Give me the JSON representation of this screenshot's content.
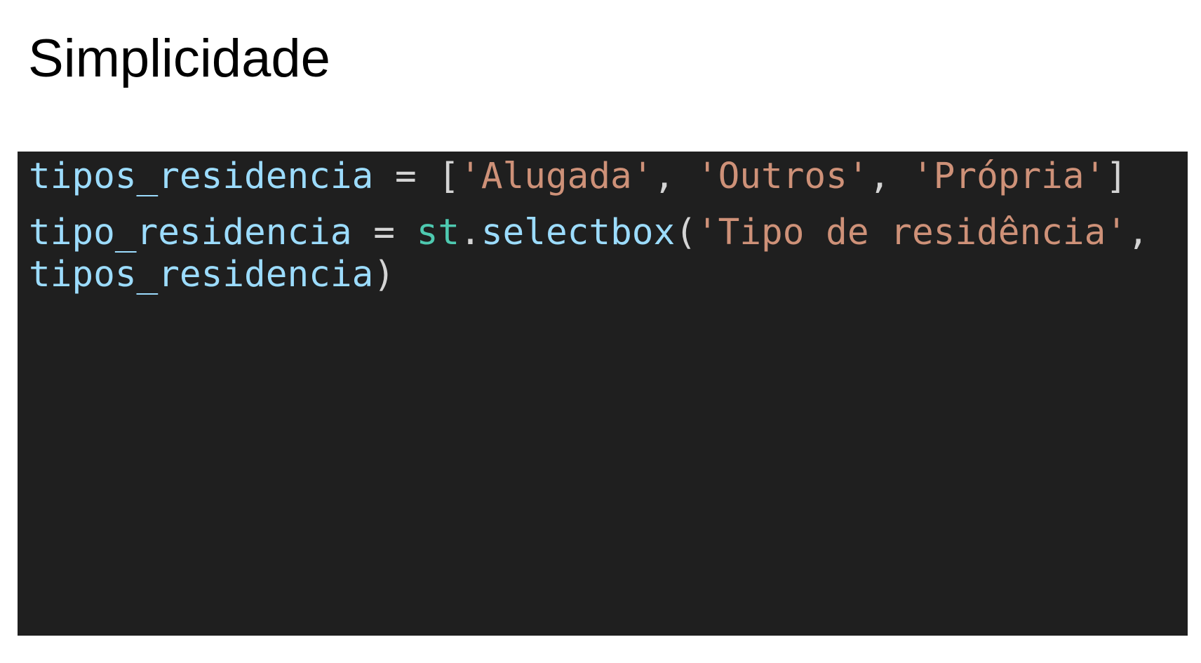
{
  "slide": {
    "title": "Simplicidade"
  },
  "code": {
    "line1": {
      "var": "tipos_residencia",
      "op": " = ",
      "open": "[",
      "s1": "'Alugada'",
      "c1": ", ",
      "s2": "'Outros'",
      "c2": ", ",
      "s3": "'Própria'",
      "close": "]"
    },
    "line2": {
      "var": "tipo_residencia",
      "op": " = ",
      "module": "st",
      "dot": ".",
      "func": "selectbox",
      "open": "(",
      "s1": "'Tipo de residência'",
      "comma": ","
    },
    "line3": {
      "arg": "tipos_residencia",
      "close": ")"
    }
  },
  "colors": {
    "code_background": "#1f1f1f",
    "variable": "#9cdcfe",
    "string": "#ce9178",
    "module": "#4ec9b0",
    "operator": "#d4d4d4"
  }
}
